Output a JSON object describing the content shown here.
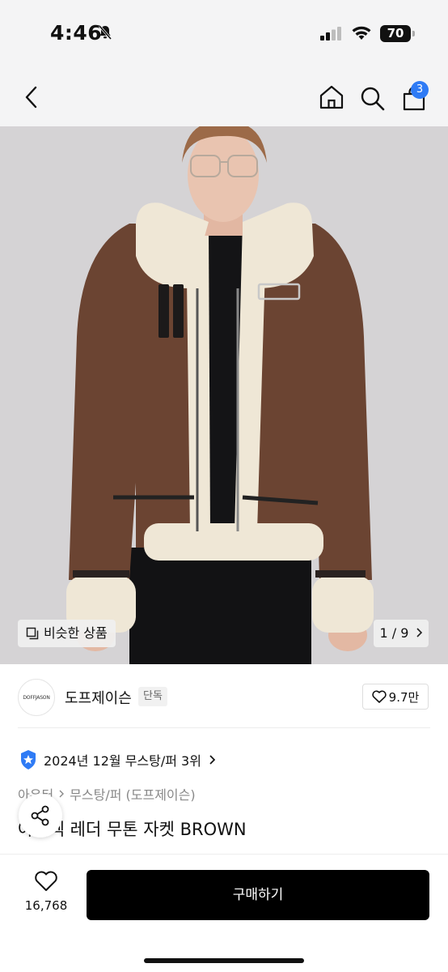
{
  "status_bar": {
    "time": "4:46",
    "battery": "70"
  },
  "nav": {
    "cart_count": "3"
  },
  "hero": {
    "similar_label": "비슷한 상품",
    "pager": "1 / 9"
  },
  "brand": {
    "logo_text": "DOFFJASON",
    "name": "도프제이슨",
    "tag": "단독",
    "likes": "9.7만"
  },
  "rank": {
    "text": "2024년 12월 무스탕/퍼 3위"
  },
  "breadcrumb": {
    "category": "아우터",
    "sub": "무스탕/퍼 (도프제이슨)"
  },
  "product": {
    "title": "아이젝 레더 무톤 자켓 BROWN"
  },
  "bottom": {
    "like_count": "16,768",
    "buy_label": "구매하기"
  },
  "colors": {
    "accent": "#2f7bf5",
    "jacket": "#6b4432",
    "shearling": "#efe7d6"
  }
}
